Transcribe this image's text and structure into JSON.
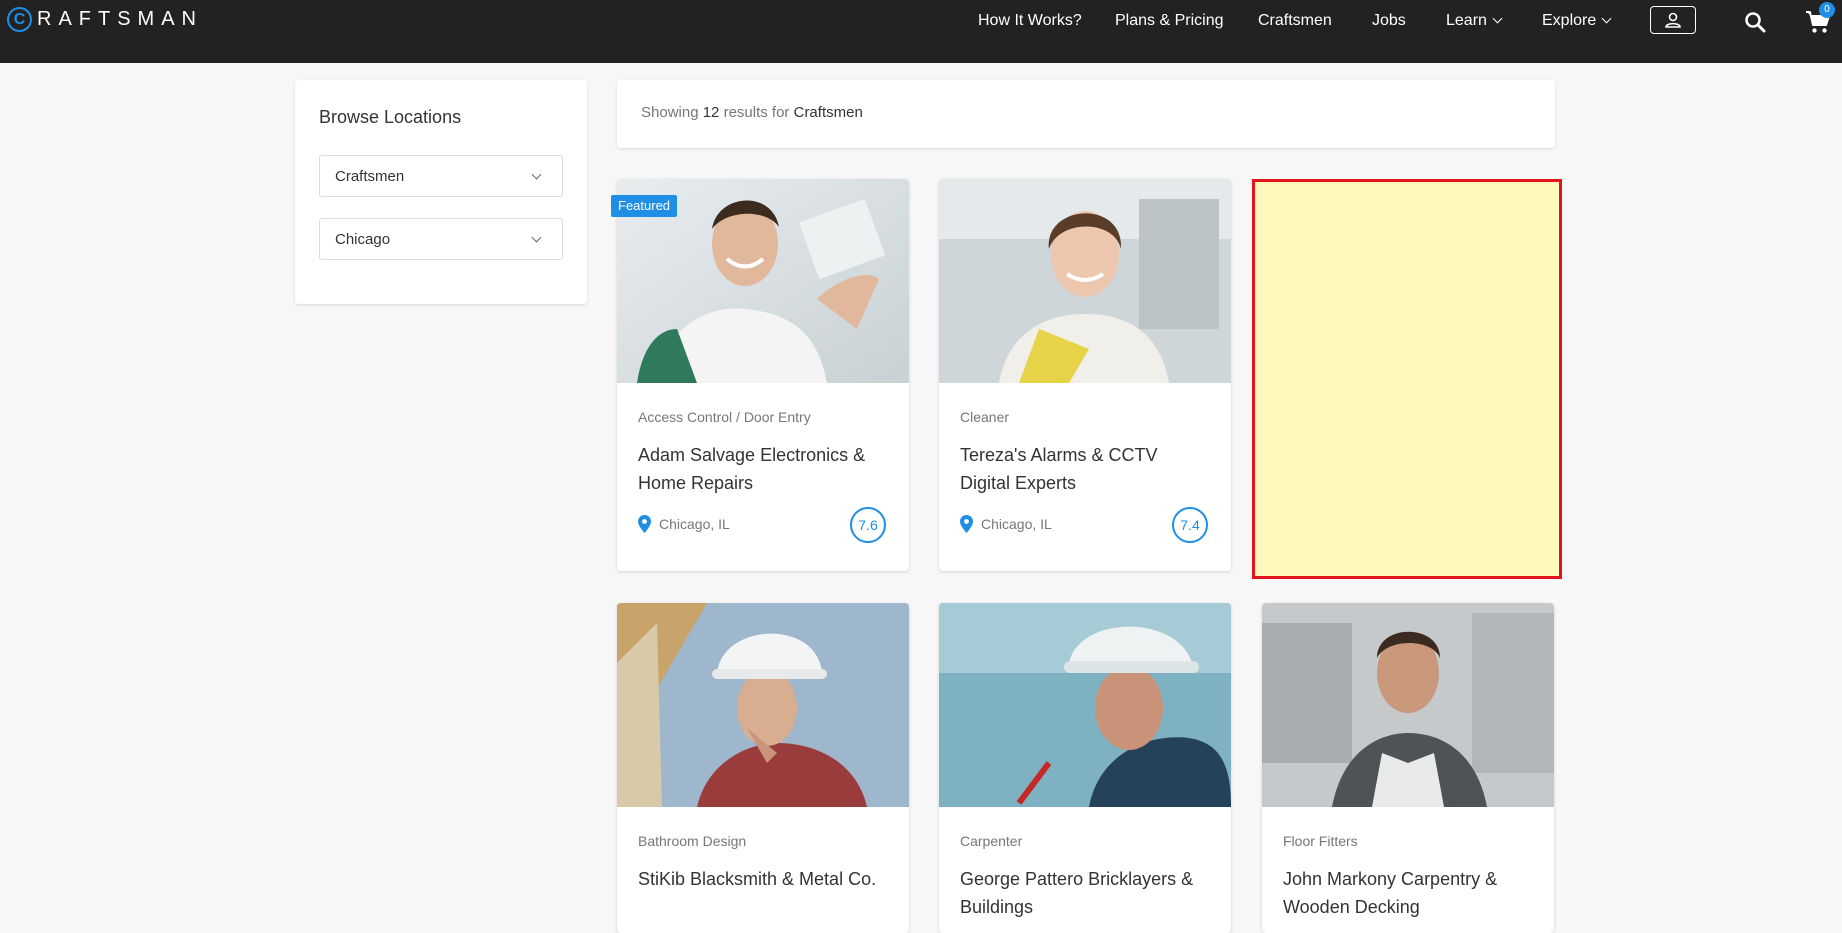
{
  "brand": {
    "letter": "C",
    "name": "RAFTSMAN"
  },
  "nav": {
    "items": [
      {
        "label": "How It Works?"
      },
      {
        "label": "Plans & Pricing"
      },
      {
        "label": "Craftsmen"
      },
      {
        "label": "Jobs"
      },
      {
        "label": "Learn"
      },
      {
        "label": "Explore"
      }
    ],
    "cart_count": "0",
    "icons": [
      "user-icon",
      "search-icon",
      "cart-icon"
    ]
  },
  "sidebar": {
    "title": "Browse Locations",
    "category_select": "Craftsmen",
    "location_select": "Chicago"
  },
  "results": {
    "prefix": "Showing",
    "count": "12",
    "middle": "results for",
    "query": "Craftsmen"
  },
  "cards": [
    {
      "badge": "Featured",
      "category": "Access Control / Door Entry",
      "title": "Adam Salvage Electronics & Home Repairs",
      "location": "Chicago, IL",
      "rating": "7.6"
    },
    {
      "category": "Cleaner",
      "title": "Tereza's Alarms & CCTV Digital Experts",
      "location": "Chicago, IL",
      "rating": "7.4"
    },
    {
      "category": "Bathroom Design",
      "title": "StiKib Blacksmith & Metal Co."
    },
    {
      "category": "Carpenter",
      "title": "George Pattero Bricklayers & Buildings"
    },
    {
      "category": "Floor Fitters",
      "title": "John Markony Carpentry & Wooden Decking"
    }
  ],
  "colors": {
    "accent": "#1e8fe5",
    "navbar": "#222222",
    "highlight_border": "#e3141c",
    "highlight_fill": "#fff8bc"
  }
}
